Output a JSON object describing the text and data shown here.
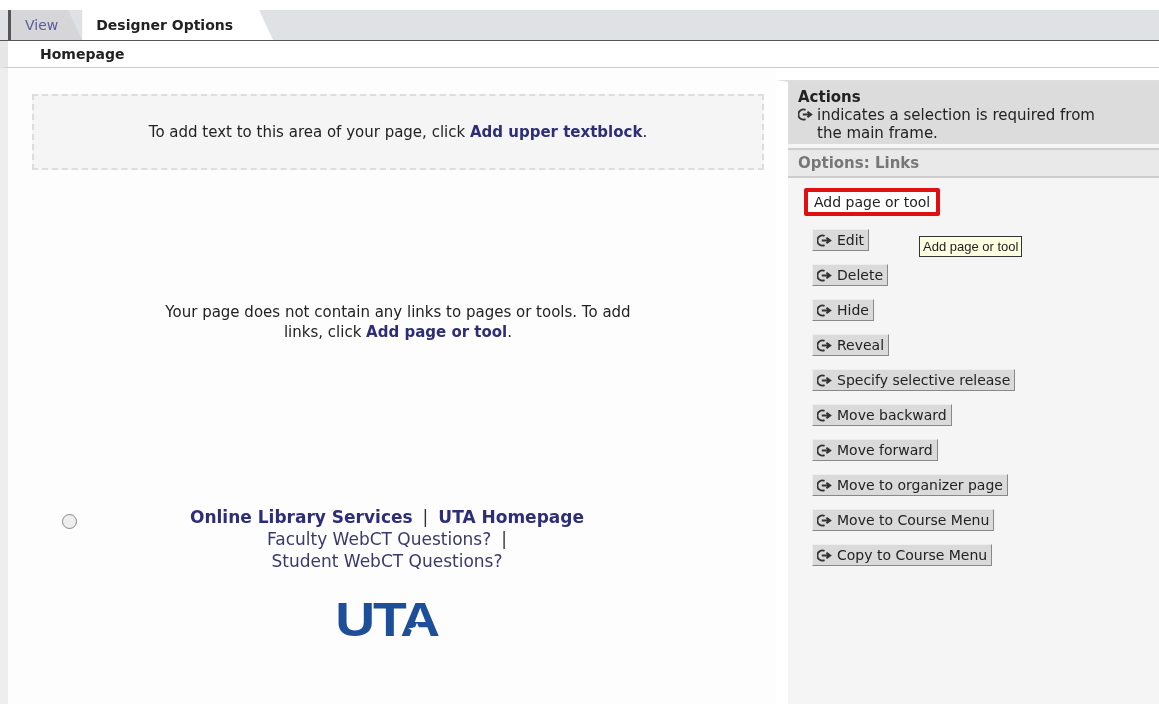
{
  "tabs": [
    {
      "label": "View",
      "selected": false
    },
    {
      "label": "Designer Options",
      "selected": true
    }
  ],
  "page_title": "Homepage",
  "upper_textblock": {
    "text": "To add text to this area of your page, click **Add upper textblock**."
  },
  "empty_message": {
    "text": "Your page does not contain any links to pages or tools. To add links, click **Add page or tool**."
  },
  "footer": {
    "radio": {
      "checked": false
    },
    "lines": [
      {
        "links": [
          {
            "label": "Online Library Services",
            "bold": true
          },
          {
            "label": "UTA Homepage",
            "bold": true
          }
        ],
        "separator": "|"
      },
      {
        "links": [
          {
            "label": "Faculty WebCT Questions?",
            "bold": false
          },
          {
            "label": "Student WebCT Questions?",
            "bold": false
          }
        ],
        "separator": "|"
      }
    ],
    "logo": "UTA"
  },
  "actions": {
    "title": "Actions",
    "note": "indicates a selection is required from the main frame.",
    "options_title": "Options: Links",
    "buttons": [
      {
        "label": "Add page or tool",
        "kind": "plain",
        "highlighted": true
      },
      {
        "label": "Edit",
        "kind": "selection",
        "highlighted": false
      },
      {
        "label": "Delete",
        "kind": "selection",
        "highlighted": false
      },
      {
        "label": "Hide",
        "kind": "selection",
        "highlighted": false
      },
      {
        "label": "Reveal",
        "kind": "selection",
        "highlighted": false
      },
      {
        "label": "Specify selective release",
        "kind": "selection",
        "highlighted": false
      },
      {
        "label": "Move backward",
        "kind": "selection",
        "highlighted": false
      },
      {
        "label": "Move forward",
        "kind": "selection",
        "highlighted": false
      },
      {
        "label": "Move to organizer page",
        "kind": "selection",
        "highlighted": false
      },
      {
        "label": "Move to Course Menu",
        "kind": "selection",
        "highlighted": false
      },
      {
        "label": "Copy to Course Menu",
        "kind": "selection",
        "highlighted": false
      }
    ],
    "tooltip": "Add page or tool"
  }
}
